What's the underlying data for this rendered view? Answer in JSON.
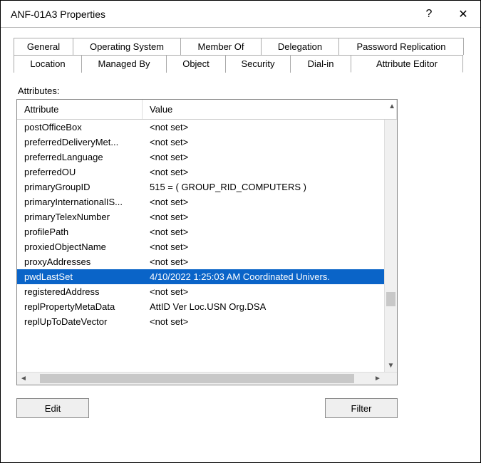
{
  "window": {
    "title": "ANF-01A3 Properties",
    "help": "?",
    "close": "✕"
  },
  "tabs_row1": [
    {
      "label": "General"
    },
    {
      "label": "Operating System"
    },
    {
      "label": "Member Of"
    },
    {
      "label": "Delegation"
    },
    {
      "label": "Password Replication"
    }
  ],
  "tabs_row2": [
    {
      "label": "Location"
    },
    {
      "label": "Managed By"
    },
    {
      "label": "Object"
    },
    {
      "label": "Security"
    },
    {
      "label": "Dial-in"
    },
    {
      "label": "Attribute Editor",
      "active": true
    }
  ],
  "attributes_label": "Attributes:",
  "columns": {
    "attr": "Attribute",
    "val": "Value"
  },
  "rows": [
    {
      "attr": "postOfficeBox",
      "val": "<not set>"
    },
    {
      "attr": "preferredDeliveryMet...",
      "val": "<not set>"
    },
    {
      "attr": "preferredLanguage",
      "val": "<not set>"
    },
    {
      "attr": "preferredOU",
      "val": "<not set>"
    },
    {
      "attr": "primaryGroupID",
      "val": "515 = ( GROUP_RID_COMPUTERS )"
    },
    {
      "attr": "primaryInternationalIS...",
      "val": "<not set>"
    },
    {
      "attr": "primaryTelexNumber",
      "val": "<not set>"
    },
    {
      "attr": "profilePath",
      "val": "<not set>"
    },
    {
      "attr": "proxiedObjectName",
      "val": "<not set>"
    },
    {
      "attr": "proxyAddresses",
      "val": "<not set>"
    },
    {
      "attr": "pwdLastSet",
      "val": "4/10/2022 1:25:03 AM Coordinated Univers.",
      "selected": true
    },
    {
      "attr": "registeredAddress",
      "val": "<not set>"
    },
    {
      "attr": "replPropertyMetaData",
      "val": " AttID  Ver      Loc.USN                   Org.DSA"
    },
    {
      "attr": "replUpToDateVector",
      "val": "<not set>"
    }
  ],
  "buttons": {
    "edit": "Edit",
    "filter": "Filter"
  }
}
